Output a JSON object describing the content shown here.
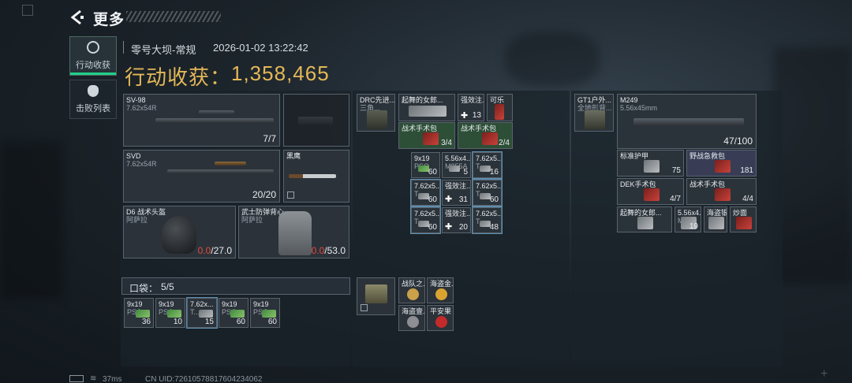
{
  "header": {
    "title": "更多"
  },
  "tabs": [
    {
      "label": "行动收获",
      "active": true,
      "icon": "target-icon"
    },
    {
      "label": "击败列表",
      "active": false,
      "icon": "skull-icon"
    }
  ],
  "match": {
    "map": "零号大坝-常规",
    "datetime": "2026-01-02 13:22:42"
  },
  "hauls": {
    "label": "行动收获：",
    "value": "1,358,465"
  },
  "loadout": {
    "primary": {
      "name": "SV-98",
      "caliber": "7.62x54R",
      "count": "7/7"
    },
    "secondary": {
      "name": "SVD",
      "caliber": "7.62x54R",
      "count": "20/20"
    },
    "melee": {
      "name": "黑鹰"
    },
    "helmet": {
      "name": "D6 战术头盔",
      "brand": "阿萨拉",
      "durability_current": "0.0",
      "durability_max": "/27.0"
    },
    "armor": {
      "name": "武士防弹背心",
      "brand": "阿萨拉",
      "durability_current": "0.0",
      "durability_max": "/53.0"
    }
  },
  "pocket": {
    "label": "口袋：",
    "capacity": "5/5",
    "items": [
      {
        "name": "9x19",
        "sub": "PSO",
        "count": "36"
      },
      {
        "name": "9x19",
        "sub": "PSO",
        "count": "10"
      },
      {
        "name": "7.62x...",
        "sub": "T...",
        "count": "15"
      },
      {
        "name": "9x19",
        "sub": "PSO",
        "count": "60"
      },
      {
        "name": "9x19",
        "sub": "PSO",
        "count": "60"
      }
    ]
  },
  "chest_rig": {
    "name": "DRC先进...",
    "sub": "三角..."
  },
  "rig_items": [
    {
      "name": "起舞的女郎...",
      "count": ""
    },
    {
      "name": "强效注...",
      "count": "13"
    },
    {
      "name": "可乐",
      "count": ""
    },
    {
      "name": "战术手术包",
      "count": "3/4"
    },
    {
      "name": "战术手术包",
      "count": "2/4"
    }
  ],
  "ammo_grid": [
    {
      "name": "9x19",
      "sub": "PSO",
      "count": "60"
    },
    {
      "name": "5.56x4...",
      "sub": "M855A",
      "count": "5"
    },
    {
      "name": "7.62x5...",
      "sub": "T...",
      "count": "16"
    },
    {
      "name": "7.62x5...",
      "sub": "T...",
      "count": "60"
    },
    {
      "name": "强效注...",
      "sub": "",
      "count": "31"
    },
    {
      "name": "7.62x5...",
      "sub": "T...",
      "count": "60"
    },
    {
      "name": "7.62x5...",
      "sub": "T...",
      "count": "60"
    },
    {
      "name": "强效注...",
      "sub": "",
      "count": "20"
    },
    {
      "name": "7.62x5...",
      "sub": "T...",
      "count": "48"
    }
  ],
  "safe_box": {
    "items": [
      {
        "name": "战队之...",
        "count": ""
      },
      {
        "name": "海盗金...",
        "count": ""
      },
      {
        "name": "海盗壹...",
        "count": ""
      },
      {
        "name": "平安果",
        "count": ""
      }
    ]
  },
  "backpack": {
    "name": "GT1户外...",
    "sub": "全地形背..."
  },
  "backpack_gun": {
    "name": "M249",
    "caliber": "5.56x45mm",
    "count": "47/100"
  },
  "backpack_items": [
    {
      "name": "标准护甲",
      "count": "75"
    },
    {
      "name": "野战急救包",
      "count": "181"
    },
    {
      "name": "DEK手术包",
      "count": "4/7"
    },
    {
      "name": "战术手术包",
      "count": "4/4"
    },
    {
      "name": "起舞的女郎...",
      "count": ""
    },
    {
      "name": "5.56x4...",
      "sub": "M855",
      "count": "19"
    },
    {
      "name": "海盗银...",
      "count": ""
    },
    {
      "name": "炒面",
      "count": ""
    }
  ],
  "footer": {
    "ping": "37ms",
    "uid": "CN UID:7261057881760423406​2"
  }
}
